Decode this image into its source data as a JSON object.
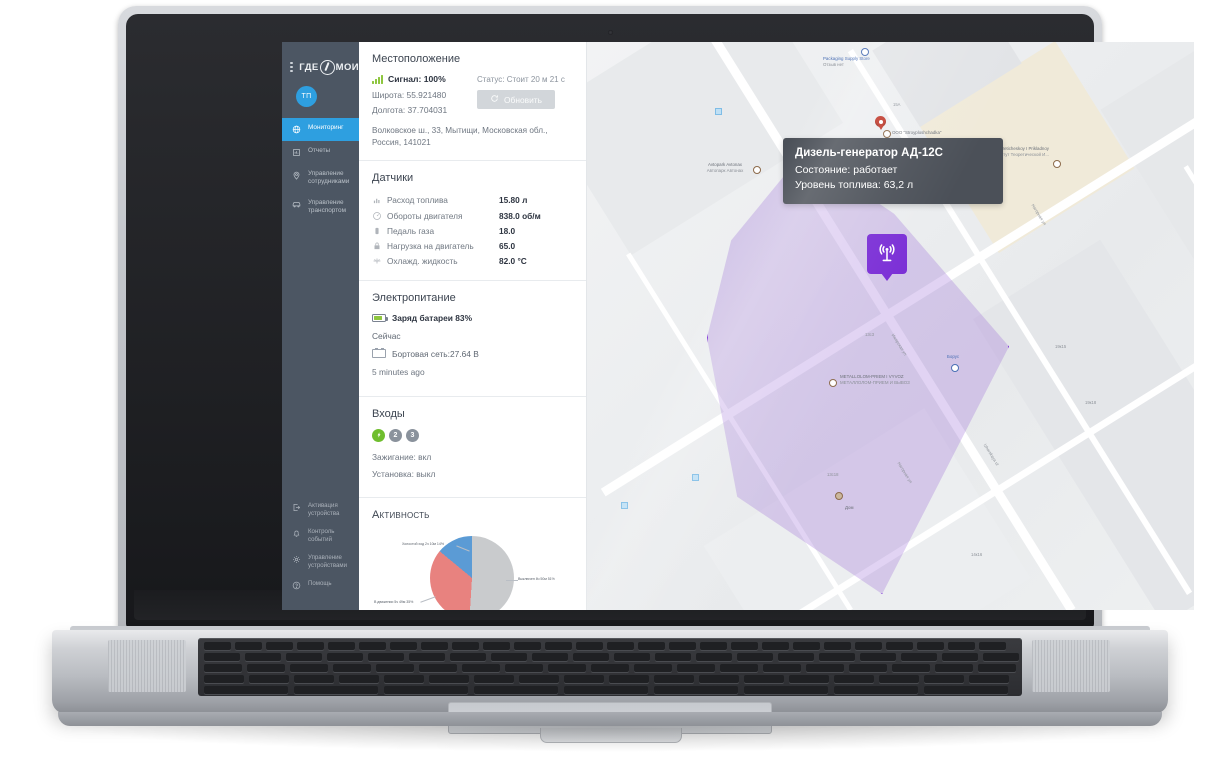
{
  "app": {
    "brand": "ГДЕ МОИ",
    "avatar_initials": "ТП"
  },
  "sidebar": {
    "menu_icon": "hamburger-icon",
    "items": [
      {
        "label": "Мониторинг",
        "icon": "globe-icon",
        "active": true
      },
      {
        "label": "Отчеты",
        "icon": "report-icon",
        "active": false
      },
      {
        "label": "Управление сотрудниками",
        "icon": "pin-icon",
        "active": false
      },
      {
        "label": "Управление транспортом",
        "icon": "car-icon",
        "active": false
      }
    ],
    "bottom_items": [
      {
        "label": "Активация устройства",
        "icon": "activate-icon"
      },
      {
        "label": "Контроль событий",
        "icon": "bell-icon"
      },
      {
        "label": "Управление устройствами",
        "icon": "gear-icon"
      },
      {
        "label": "Помощь",
        "icon": "help-icon"
      }
    ]
  },
  "location": {
    "title": "Местоположение",
    "signal": "Сигнал: 100%",
    "latitude": "Широта: 55.921480",
    "longitude": "Долгота: 37.704031",
    "address": "Волковское ш., 33, Мытищи, Московская обл., Россия, 141021",
    "status": "Статус: Стоит 20 м 21 с",
    "refresh_label": "Обновить"
  },
  "sensors": {
    "title": "Датчики",
    "rows": [
      {
        "icon": "fuel-icon",
        "label": "Расход топлива",
        "value": "15.80 л"
      },
      {
        "icon": "gauge-icon",
        "label": "Обороты двигателя",
        "value": "838.0 об/м"
      },
      {
        "icon": "pedal-icon",
        "label": "Педаль газа",
        "value": "18.0"
      },
      {
        "icon": "engine-icon",
        "label": "Нагрузка на двигатель",
        "value": "65.0"
      },
      {
        "icon": "coolant-icon",
        "label": "Охлажд. жидкость",
        "value": "82.0 °C"
      }
    ]
  },
  "power": {
    "title": "Электропитание",
    "battery": "Заряд батареи 83%",
    "now_label": "Сейчас",
    "onboard": "Бортовая сеть:27.64 В",
    "updated": "5 minutes ago"
  },
  "inputs": {
    "title": "Входы",
    "pills": [
      {
        "label": "1",
        "state": "on"
      },
      {
        "label": "2",
        "state": "off"
      },
      {
        "label": "3",
        "state": "off"
      }
    ],
    "ignition": "Зажигание: вкл",
    "install": "Установка: выкл"
  },
  "activity": {
    "title": "Активность",
    "chart_data": {
      "type": "pie",
      "title": "Активность",
      "labels": [
        "Выключен 8ч 50м 51%",
        "В движении 5ч 49м 35%",
        "Холостой ход 2ч 10м 14%"
      ],
      "values": [
        51,
        35,
        14
      ],
      "colors": [
        "#c9cbcd",
        "#e8827f",
        "#5b9bd5"
      ],
      "legend": "labels-with-leaders"
    }
  },
  "map": {
    "tooltip": {
      "title": "Дизель-генератор АД-12С",
      "state": "Состояние: работает",
      "fuel": "Уровень топлива: 63,2 л"
    },
    "device_marker_icon": "antenna-icon",
    "pois": [
      {
        "name": "Packaging Supply Store",
        "sub": "Отзыв нет",
        "style": "blue"
      },
      {
        "name": "OOO \"Stroyploshchadka\"",
        "sub": "",
        "style": "dark"
      },
      {
        "name": "Institut Teoreticheskoy I Prikladnoy",
        "sub": "Институт Теоретической И...",
        "style": "dark"
      },
      {
        "name": "Avtopark Avtonax",
        "sub": "Автопарк Автонах",
        "style": "dark"
      },
      {
        "name": "METALLOLOM-PRIEM I VYVOZ",
        "sub": "МЕТАЛЛОЛОМ-ПРИЕМ И ВЫВОЗ",
        "style": "dark"
      },
      {
        "name": "Борус",
        "sub": "",
        "style": "blue"
      },
      {
        "name": "Дом",
        "sub": "",
        "style": "dark"
      }
    ],
    "streets": [
      "Нагорная ул",
      "Izhorskaya ul",
      "Ижорская ул",
      "Нагорная ул"
    ],
    "house_numbers": [
      "15А",
      "13с3",
      "13с18",
      "19к15",
      "19к18",
      "14к16"
    ],
    "zone_color": "#7b2fd6"
  }
}
